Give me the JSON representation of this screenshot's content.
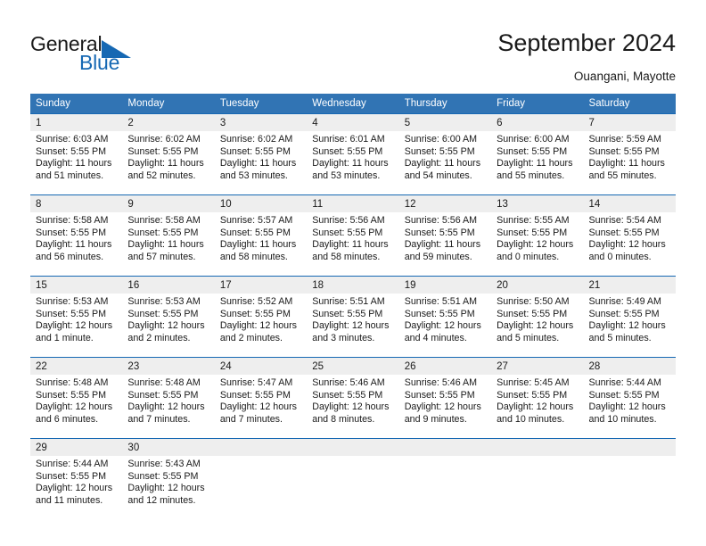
{
  "logo": {
    "primary_text": "General",
    "secondary_text": "Blue",
    "accent_color": "#1668b3",
    "triangle_icon": "triangle-icon"
  },
  "header": {
    "title": "September 2024",
    "subtitle": "Ouangani, Mayotte"
  },
  "calendar": {
    "header_color": "#3174b4",
    "grid_line_color": "#1668b3",
    "daynum_band_color": "#eeeeee",
    "weekdays": [
      "Sunday",
      "Monday",
      "Tuesday",
      "Wednesday",
      "Thursday",
      "Friday",
      "Saturday"
    ],
    "weeks": [
      [
        {
          "day": "1",
          "sunrise": "Sunrise: 6:03 AM",
          "sunset": "Sunset: 5:55 PM",
          "daylight_line1": "Daylight: 11 hours",
          "daylight_line2": "and 51 minutes."
        },
        {
          "day": "2",
          "sunrise": "Sunrise: 6:02 AM",
          "sunset": "Sunset: 5:55 PM",
          "daylight_line1": "Daylight: 11 hours",
          "daylight_line2": "and 52 minutes."
        },
        {
          "day": "3",
          "sunrise": "Sunrise: 6:02 AM",
          "sunset": "Sunset: 5:55 PM",
          "daylight_line1": "Daylight: 11 hours",
          "daylight_line2": "and 53 minutes."
        },
        {
          "day": "4",
          "sunrise": "Sunrise: 6:01 AM",
          "sunset": "Sunset: 5:55 PM",
          "daylight_line1": "Daylight: 11 hours",
          "daylight_line2": "and 53 minutes."
        },
        {
          "day": "5",
          "sunrise": "Sunrise: 6:00 AM",
          "sunset": "Sunset: 5:55 PM",
          "daylight_line1": "Daylight: 11 hours",
          "daylight_line2": "and 54 minutes."
        },
        {
          "day": "6",
          "sunrise": "Sunrise: 6:00 AM",
          "sunset": "Sunset: 5:55 PM",
          "daylight_line1": "Daylight: 11 hours",
          "daylight_line2": "and 55 minutes."
        },
        {
          "day": "7",
          "sunrise": "Sunrise: 5:59 AM",
          "sunset": "Sunset: 5:55 PM",
          "daylight_line1": "Daylight: 11 hours",
          "daylight_line2": "and 55 minutes."
        }
      ],
      [
        {
          "day": "8",
          "sunrise": "Sunrise: 5:58 AM",
          "sunset": "Sunset: 5:55 PM",
          "daylight_line1": "Daylight: 11 hours",
          "daylight_line2": "and 56 minutes."
        },
        {
          "day": "9",
          "sunrise": "Sunrise: 5:58 AM",
          "sunset": "Sunset: 5:55 PM",
          "daylight_line1": "Daylight: 11 hours",
          "daylight_line2": "and 57 minutes."
        },
        {
          "day": "10",
          "sunrise": "Sunrise: 5:57 AM",
          "sunset": "Sunset: 5:55 PM",
          "daylight_line1": "Daylight: 11 hours",
          "daylight_line2": "and 58 minutes."
        },
        {
          "day": "11",
          "sunrise": "Sunrise: 5:56 AM",
          "sunset": "Sunset: 5:55 PM",
          "daylight_line1": "Daylight: 11 hours",
          "daylight_line2": "and 58 minutes."
        },
        {
          "day": "12",
          "sunrise": "Sunrise: 5:56 AM",
          "sunset": "Sunset: 5:55 PM",
          "daylight_line1": "Daylight: 11 hours",
          "daylight_line2": "and 59 minutes."
        },
        {
          "day": "13",
          "sunrise": "Sunrise: 5:55 AM",
          "sunset": "Sunset: 5:55 PM",
          "daylight_line1": "Daylight: 12 hours",
          "daylight_line2": "and 0 minutes."
        },
        {
          "day": "14",
          "sunrise": "Sunrise: 5:54 AM",
          "sunset": "Sunset: 5:55 PM",
          "daylight_line1": "Daylight: 12 hours",
          "daylight_line2": "and 0 minutes."
        }
      ],
      [
        {
          "day": "15",
          "sunrise": "Sunrise: 5:53 AM",
          "sunset": "Sunset: 5:55 PM",
          "daylight_line1": "Daylight: 12 hours",
          "daylight_line2": "and 1 minute."
        },
        {
          "day": "16",
          "sunrise": "Sunrise: 5:53 AM",
          "sunset": "Sunset: 5:55 PM",
          "daylight_line1": "Daylight: 12 hours",
          "daylight_line2": "and 2 minutes."
        },
        {
          "day": "17",
          "sunrise": "Sunrise: 5:52 AM",
          "sunset": "Sunset: 5:55 PM",
          "daylight_line1": "Daylight: 12 hours",
          "daylight_line2": "and 2 minutes."
        },
        {
          "day": "18",
          "sunrise": "Sunrise: 5:51 AM",
          "sunset": "Sunset: 5:55 PM",
          "daylight_line1": "Daylight: 12 hours",
          "daylight_line2": "and 3 minutes."
        },
        {
          "day": "19",
          "sunrise": "Sunrise: 5:51 AM",
          "sunset": "Sunset: 5:55 PM",
          "daylight_line1": "Daylight: 12 hours",
          "daylight_line2": "and 4 minutes."
        },
        {
          "day": "20",
          "sunrise": "Sunrise: 5:50 AM",
          "sunset": "Sunset: 5:55 PM",
          "daylight_line1": "Daylight: 12 hours",
          "daylight_line2": "and 5 minutes."
        },
        {
          "day": "21",
          "sunrise": "Sunrise: 5:49 AM",
          "sunset": "Sunset: 5:55 PM",
          "daylight_line1": "Daylight: 12 hours",
          "daylight_line2": "and 5 minutes."
        }
      ],
      [
        {
          "day": "22",
          "sunrise": "Sunrise: 5:48 AM",
          "sunset": "Sunset: 5:55 PM",
          "daylight_line1": "Daylight: 12 hours",
          "daylight_line2": "and 6 minutes."
        },
        {
          "day": "23",
          "sunrise": "Sunrise: 5:48 AM",
          "sunset": "Sunset: 5:55 PM",
          "daylight_line1": "Daylight: 12 hours",
          "daylight_line2": "and 7 minutes."
        },
        {
          "day": "24",
          "sunrise": "Sunrise: 5:47 AM",
          "sunset": "Sunset: 5:55 PM",
          "daylight_line1": "Daylight: 12 hours",
          "daylight_line2": "and 7 minutes."
        },
        {
          "day": "25",
          "sunrise": "Sunrise: 5:46 AM",
          "sunset": "Sunset: 5:55 PM",
          "daylight_line1": "Daylight: 12 hours",
          "daylight_line2": "and 8 minutes."
        },
        {
          "day": "26",
          "sunrise": "Sunrise: 5:46 AM",
          "sunset": "Sunset: 5:55 PM",
          "daylight_line1": "Daylight: 12 hours",
          "daylight_line2": "and 9 minutes."
        },
        {
          "day": "27",
          "sunrise": "Sunrise: 5:45 AM",
          "sunset": "Sunset: 5:55 PM",
          "daylight_line1": "Daylight: 12 hours",
          "daylight_line2": "and 10 minutes."
        },
        {
          "day": "28",
          "sunrise": "Sunrise: 5:44 AM",
          "sunset": "Sunset: 5:55 PM",
          "daylight_line1": "Daylight: 12 hours",
          "daylight_line2": "and 10 minutes."
        }
      ],
      [
        {
          "day": "29",
          "sunrise": "Sunrise: 5:44 AM",
          "sunset": "Sunset: 5:55 PM",
          "daylight_line1": "Daylight: 12 hours",
          "daylight_line2": "and 11 minutes."
        },
        {
          "day": "30",
          "sunrise": "Sunrise: 5:43 AM",
          "sunset": "Sunset: 5:55 PM",
          "daylight_line1": "Daylight: 12 hours",
          "daylight_line2": "and 12 minutes."
        },
        {
          "day": "",
          "sunrise": "",
          "sunset": "",
          "daylight_line1": "",
          "daylight_line2": ""
        },
        {
          "day": "",
          "sunrise": "",
          "sunset": "",
          "daylight_line1": "",
          "daylight_line2": ""
        },
        {
          "day": "",
          "sunrise": "",
          "sunset": "",
          "daylight_line1": "",
          "daylight_line2": ""
        },
        {
          "day": "",
          "sunrise": "",
          "sunset": "",
          "daylight_line1": "",
          "daylight_line2": ""
        },
        {
          "day": "",
          "sunrise": "",
          "sunset": "",
          "daylight_line1": "",
          "daylight_line2": ""
        }
      ]
    ]
  }
}
